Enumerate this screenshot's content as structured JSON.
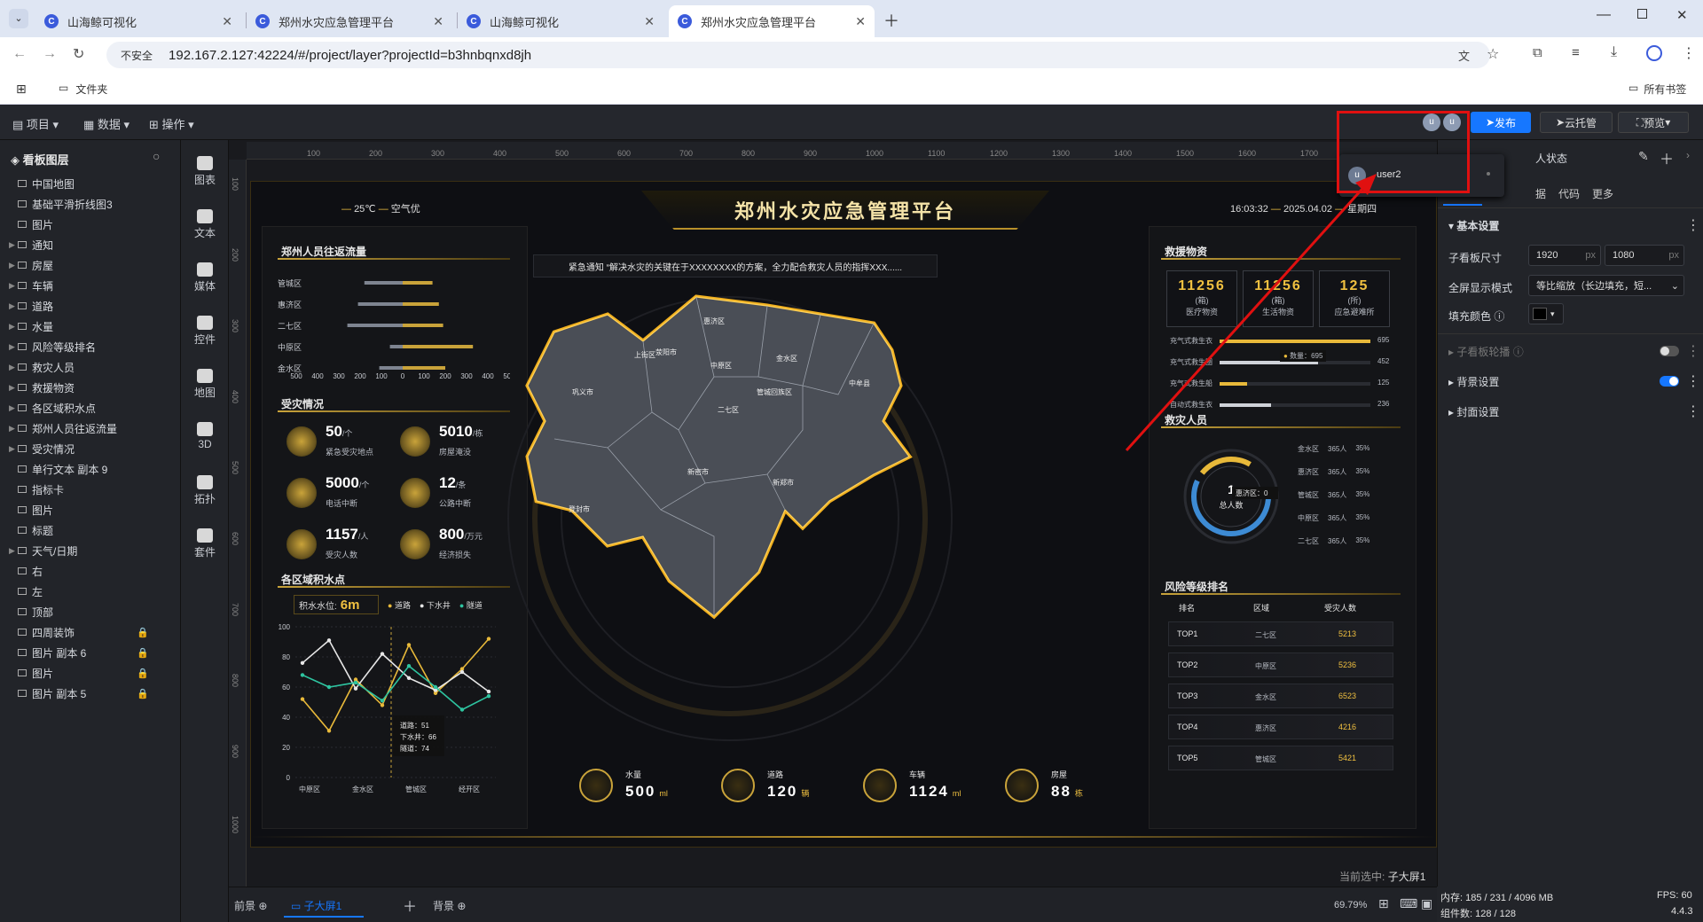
{
  "browser": {
    "tabs": [
      {
        "label": "山海鲸可视化",
        "active": false
      },
      {
        "label": "郑州水灾应急管理平台",
        "active": false
      },
      {
        "label": "山海鲸可视化",
        "active": false
      },
      {
        "label": "郑州水灾应急管理平台",
        "active": true
      }
    ],
    "secure_label": "不安全",
    "url": "192.167.2.127:42224/#/project/layer?projectId=b3hnbqnxd8jh",
    "bookmark_folder": "文件夹",
    "all_bookmarks": "所有书签"
  },
  "app_toolbar": {
    "menus": [
      "项目",
      "数据",
      "操作"
    ],
    "publish": "发布",
    "cloud": "云托管",
    "preview": "预览",
    "avatars": [
      "u",
      "u"
    ]
  },
  "user_popup": {
    "avatar": "u",
    "name": "user2"
  },
  "layers": {
    "title": "看板图层",
    "items": [
      {
        "label": "中国地图",
        "expand": false,
        "locked": false
      },
      {
        "label": "基础平滑折线图3",
        "expand": false,
        "locked": false
      },
      {
        "label": "图片",
        "expand": false,
        "locked": false
      },
      {
        "label": "通知",
        "expand": true,
        "locked": false
      },
      {
        "label": "房屋",
        "expand": true,
        "locked": false
      },
      {
        "label": "车辆",
        "expand": true,
        "locked": false
      },
      {
        "label": "道路",
        "expand": true,
        "locked": false
      },
      {
        "label": "水量",
        "expand": true,
        "locked": false
      },
      {
        "label": "风险等级排名",
        "expand": true,
        "locked": false
      },
      {
        "label": "救灾人员",
        "expand": true,
        "locked": false
      },
      {
        "label": "救援物资",
        "expand": true,
        "locked": false
      },
      {
        "label": "各区域积水点",
        "expand": true,
        "locked": false
      },
      {
        "label": "郑州人员往返流量",
        "expand": true,
        "locked": false
      },
      {
        "label": "受灾情况",
        "expand": true,
        "locked": false
      },
      {
        "label": "单行文本 副本 9",
        "expand": false,
        "locked": false
      },
      {
        "label": "指标卡",
        "expand": false,
        "locked": false
      },
      {
        "label": "图片",
        "expand": false,
        "locked": false
      },
      {
        "label": "标题",
        "expand": false,
        "locked": false
      },
      {
        "label": "天气/日期",
        "expand": true,
        "locked": false
      },
      {
        "label": "右",
        "expand": false,
        "locked": false
      },
      {
        "label": "左",
        "expand": false,
        "locked": false
      },
      {
        "label": "顶部",
        "expand": false,
        "locked": false
      },
      {
        "label": "四周装饰",
        "expand": false,
        "locked": true
      },
      {
        "label": "图片 副本 6",
        "expand": false,
        "locked": true
      },
      {
        "label": "图片",
        "expand": false,
        "locked": true
      },
      {
        "label": "图片 副本 5",
        "expand": false,
        "locked": true
      }
    ]
  },
  "tools": [
    "图表",
    "文本",
    "媒体",
    "控件",
    "地图",
    "3D",
    "拓扑",
    "套件"
  ],
  "ruler_h": [
    "100",
    "200",
    "300",
    "400",
    "500",
    "600",
    "700",
    "800",
    "900",
    "1000",
    "1100",
    "1200",
    "1300",
    "1400",
    "1500",
    "1600",
    "1700"
  ],
  "ruler_v": [
    "100",
    "200",
    "300",
    "400",
    "500",
    "600",
    "700",
    "800",
    "900",
    "1000"
  ],
  "dashboard": {
    "title": "郑州水灾应急管理平台",
    "weather_temp": "25℃",
    "weather_air": "空气优",
    "time": "16:03:32",
    "date": "2025.04.02",
    "weekday": "星期四",
    "notice": "紧急通知 “解决水灾的关键在于XXXXXXXX的方案，全力配合救灾人员的指挥XXX......",
    "flow": {
      "title": "郑州人员往返流量",
      "districts": [
        "管城区",
        "惠济区",
        "二七区",
        "中原区",
        "金水区"
      ],
      "out_values": [
        180,
        210,
        260,
        60,
        110
      ],
      "in_values": [
        140,
        170,
        190,
        330,
        200
      ],
      "ticks": [
        "500",
        "400",
        "300",
        "200",
        "100",
        "0",
        "100",
        "200",
        "300",
        "400",
        "500"
      ]
    },
    "disaster": {
      "title": "受灾情况",
      "items": [
        {
          "value": "50",
          "unit": "/个",
          "label": "紧急受灾地点"
        },
        {
          "value": "5010",
          "unit": "/栋",
          "label": "房屋淹没"
        },
        {
          "value": "5000",
          "unit": "/个",
          "label": "电话中断"
        },
        {
          "value": "12",
          "unit": "/条",
          "label": "公路中断"
        },
        {
          "value": "1157",
          "unit": "/人",
          "label": "受灾人数"
        },
        {
          "value": "800",
          "unit": "/万元",
          "label": "经济损失"
        }
      ]
    },
    "water": {
      "title": "各区域积水点",
      "level_label": "积水水位:",
      "level_value": "6m",
      "legend": [
        "道路",
        "下水井",
        "隧道"
      ]
    },
    "chart_data": {
      "type": "line",
      "categories": [
        "中原区",
        "",
        "金水区",
        "",
        "管城区",
        "",
        "经开区",
        ""
      ],
      "series": [
        {
          "name": "道路",
          "values": [
            52,
            31,
            65,
            48,
            88,
            56,
            72,
            92
          ],
          "color": "#e8b93a"
        },
        {
          "name": "下水井",
          "values": [
            76,
            91,
            59,
            82,
            66,
            58,
            70,
            57
          ],
          "color": "#e6e6e6"
        },
        {
          "name": "隧道",
          "values": [
            68,
            60,
            63,
            51,
            74,
            60,
            45,
            54
          ],
          "color": "#2ec4a0"
        }
      ],
      "yticks": [
        "0",
        "20",
        "40",
        "60",
        "80",
        "100"
      ],
      "ylim": [
        0,
        100
      ],
      "tooltip": {
        "a": "道路：51",
        "b": "下水井：66",
        "c": "隧道：74"
      }
    },
    "supplies": {
      "title": "救援物资",
      "cards": [
        {
          "value": "11256",
          "unit": "(箱)",
          "label": "医疗物资"
        },
        {
          "value": "11256",
          "unit": "(箱)",
          "label": "生活物资"
        },
        {
          "value": "125",
          "unit": "(所)",
          "label": "应急避难所"
        }
      ],
      "bars": [
        {
          "label": "充气式救生衣",
          "value": 695,
          "text": "695",
          "fill": 1.0
        },
        {
          "label": "充气式救生圈",
          "value": 452,
          "text": "452",
          "fill": 0.65
        },
        {
          "label": "充气式救生船",
          "value": 125,
          "text": "125",
          "fill": 0.18
        },
        {
          "label": "自动式救生衣",
          "value": 236,
          "text": "236",
          "fill": 0.34
        }
      ],
      "tip_label": "数量：",
      "tip_value": "695"
    },
    "rescuers": {
      "title": "救灾人员",
      "center_label": "总人数",
      "center_value": "1",
      "tip": "惠济区：0",
      "rows": [
        {
          "district": "金水区",
          "count": "365人",
          "pct": "35%"
        },
        {
          "district": "惠济区",
          "count": "365人",
          "pct": "35%"
        },
        {
          "district": "管城区",
          "count": "365人",
          "pct": "35%"
        },
        {
          "district": "中原区",
          "count": "365人",
          "pct": "35%"
        },
        {
          "district": "二七区",
          "count": "365人",
          "pct": "35%"
        }
      ]
    },
    "risk": {
      "title": "风险等级排名",
      "headers": [
        "排名",
        "区域",
        "受灾人数"
      ],
      "rows": [
        {
          "rank": "TOP1",
          "area": "二七区",
          "count": "5213"
        },
        {
          "rank": "TOP2",
          "area": "中原区",
          "count": "5236"
        },
        {
          "rank": "TOP3",
          "area": "金水区",
          "count": "6523"
        },
        {
          "rank": "TOP4",
          "area": "惠济区",
          "count": "4216"
        },
        {
          "rank": "TOP5",
          "area": "管城区",
          "count": "5421"
        }
      ]
    },
    "bottom_stats": [
      {
        "label": "水量",
        "value": "500",
        "unit": "ml"
      },
      {
        "label": "道路",
        "value": "120",
        "unit": "辆"
      },
      {
        "label": "车辆",
        "value": "1124",
        "unit": "ml"
      },
      {
        "label": "房屋",
        "value": "88",
        "unit": "栋"
      }
    ],
    "map_labels": [
      "惠济区",
      "上街区",
      "荥阳市",
      "中原区",
      "金水区",
      "巩义市",
      "二七区",
      "管城回族区",
      "中牟县",
      "新密市",
      "新郑市",
      "登封市"
    ]
  },
  "canvas_status": {
    "selected_label": "当前选中:",
    "selected_value": "子大屏1",
    "zoom": "69.79%"
  },
  "bottom_tabs": {
    "front": "前景",
    "screen": "子大屏1",
    "back": "背景"
  },
  "right_panel": {
    "header_partial": "人状态",
    "tabs": [
      "据",
      "代码",
      "更多"
    ],
    "section_basic": "基本设置",
    "size_label": "子看板尺寸",
    "width": "1920",
    "height": "1080",
    "px": "px",
    "fullscreen_label": "全屏显示模式",
    "fullscreen_value": "等比缩放（长边填充，短...",
    "fill_label": "填充颜色",
    "carousel_label": "子看板轮播",
    "bg_label": "背景设置",
    "cover_label": "封面设置"
  },
  "status": {
    "memory": "内存: 185 / 231 / 4096 MB",
    "components": "组件数: 128 / 128",
    "fps": "FPS: 60",
    "version": "4.4.3"
  },
  "colors": {
    "accent": "#1677ff",
    "gold": "#f0c040",
    "red_annotation": "#e01010"
  }
}
